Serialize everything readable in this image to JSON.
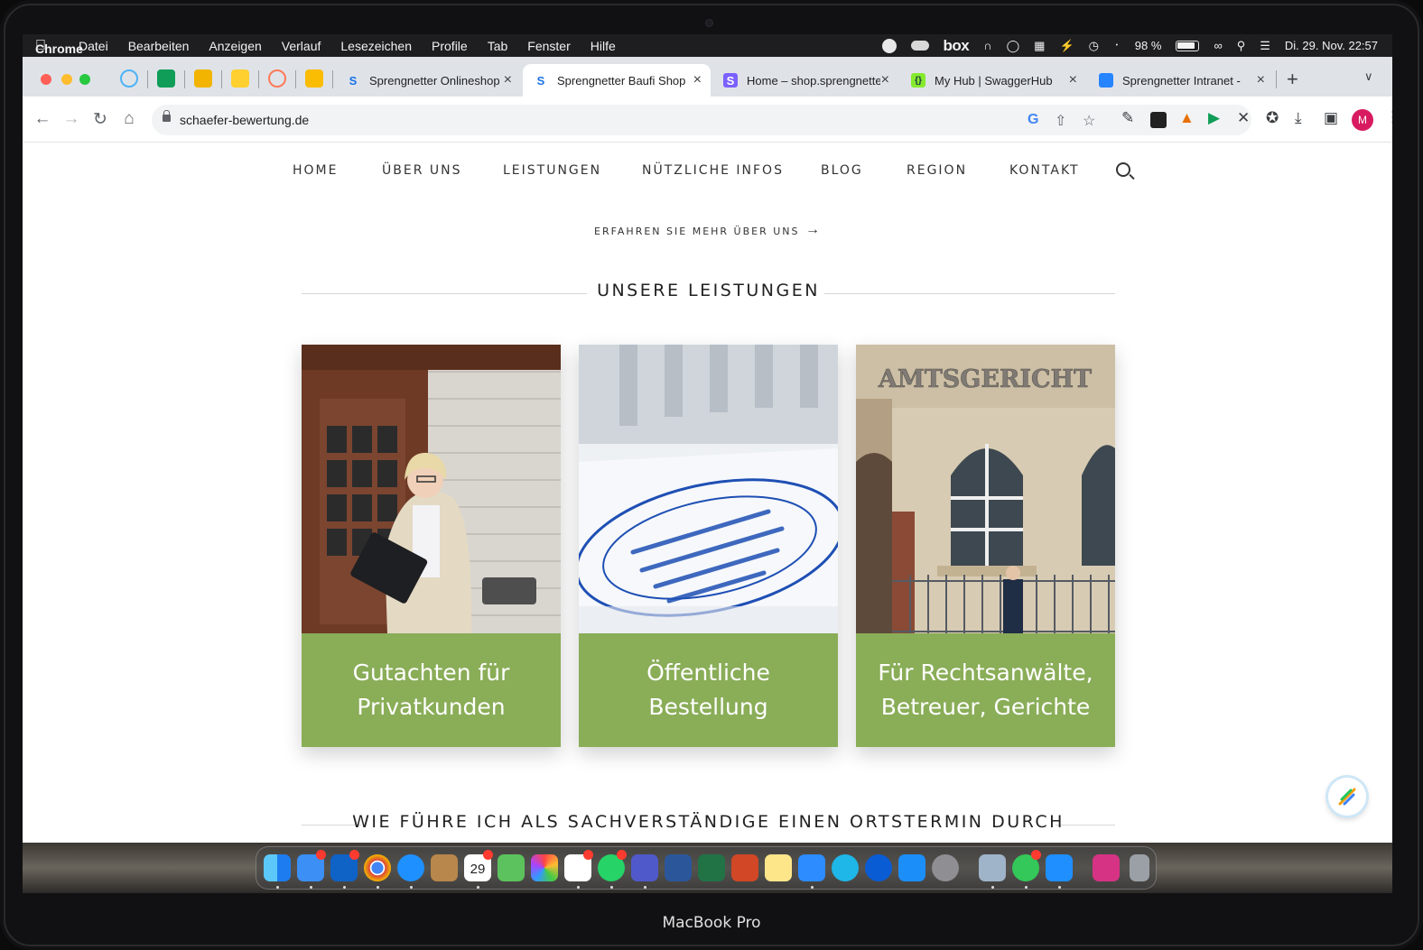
{
  "menubar": {
    "app": "Chrome",
    "items": [
      "Datei",
      "Bearbeiten",
      "Anzeigen",
      "Verlauf",
      "Lesezeichen",
      "Profile",
      "Tab",
      "Fenster",
      "Hilfe"
    ],
    "status_box": "box",
    "battery": "98 %",
    "datetime": "Di. 29. Nov.  22:57"
  },
  "tabs": [
    {
      "title": "Sprengnetter Onlineshop",
      "favicon_letter": "S",
      "favicon_color": "#1a73e8"
    },
    {
      "title": "Sprengnetter Baufi Shop",
      "favicon_letter": "S",
      "favicon_color": "#1a73e8",
      "active": true
    },
    {
      "title": "Home – shop.sprengnetter",
      "favicon_letter": "S",
      "favicon_color": "#7b61ff"
    },
    {
      "title": "My Hub | SwaggerHub",
      "favicon_letter": "{}",
      "favicon_color": "#85ea2d"
    },
    {
      "title": "Sprengnetter Intranet - ",
      "favicon_letter": "",
      "favicon_color": "#2684ff"
    }
  ],
  "address": {
    "url": "schaefer-bewertung.de"
  },
  "profile": {
    "initial": "M",
    "color": "#d81b60"
  },
  "site": {
    "nav": [
      "HOME",
      "ÜBER UNS",
      "LEISTUNGEN",
      "NÜTZLICHE INFOS",
      "BLOG",
      "REGION",
      "KONTAKT"
    ],
    "more_link": "ERFAHREN SIE MEHR ÜBER UNS",
    "section_title": "UNSERE LEISTUNGEN",
    "cards": [
      {
        "title": "Gutachten für Privatkunden"
      },
      {
        "title": "Öffentliche Bestellung"
      },
      {
        "title": "Für Rechtsanwälte, Betreuer, Gerichte",
        "sign": "AMTSGERICHT"
      }
    ],
    "next_section_title": "WIE FÜHRE ICH ALS SACHVERSTÄNDIGE EINEN ORTSTERMIN DURCH",
    "accent_color": "#8aad58"
  },
  "dock": {
    "calendar_day": "29"
  },
  "device_label": "MacBook Pro"
}
